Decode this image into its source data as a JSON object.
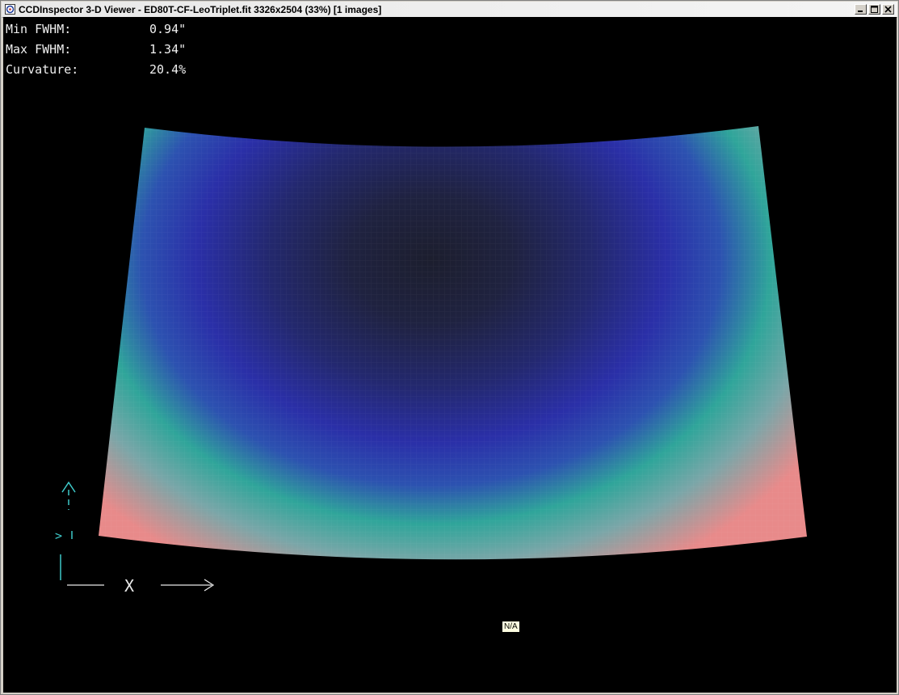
{
  "window": {
    "title": "CCDInspector 3-D Viewer - ED80T-CF-LeoTriplet.fit 3326x2504 (33%)  [1 images]",
    "buttons": [
      "minimize-icon",
      "maximize-icon",
      "close-icon"
    ]
  },
  "stats": {
    "min_fwhm_label": "Min FWHM:",
    "min_fwhm_value": "0.94\"",
    "max_fwhm_label": "Max FWHM:",
    "max_fwhm_value": "1.34\"",
    "curvature_label": "Curvature:",
    "curvature_value": "20.4%"
  },
  "axes": {
    "x_label": "X",
    "y_label": ">"
  },
  "badge": "N/A",
  "colors": {
    "background": "#000000",
    "surface_low": "#1c1e2e",
    "surface_mid": "#2a2fa8",
    "surface_teal": "#2fa59a",
    "surface_high": "#e88a8a",
    "axis": "#3ec9c9"
  }
}
